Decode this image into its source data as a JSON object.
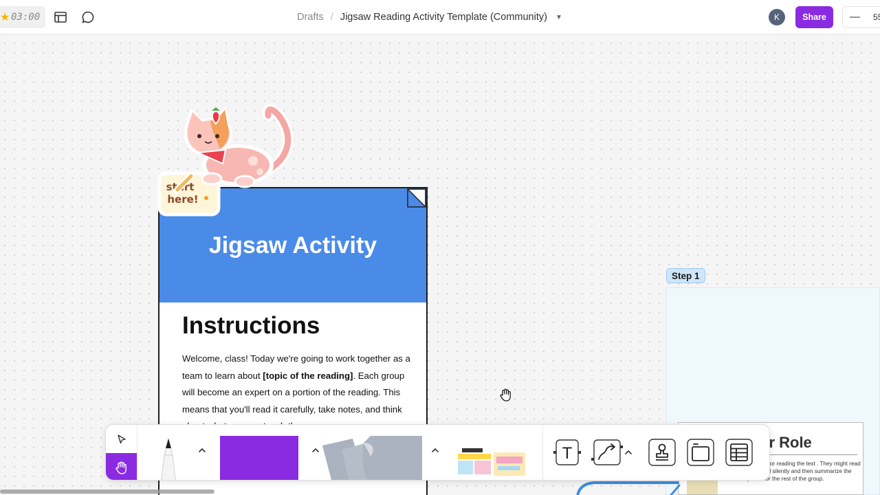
{
  "header": {
    "timer": "03:00",
    "breadcrumb_root": "Drafts",
    "breadcrumb_separator": "/",
    "file_title": "Jigsaw Reading Activity Template (Community)",
    "avatar_initial": "K",
    "share_label": "Share",
    "zoom_minus": "—",
    "zoom_value": "55"
  },
  "canvas": {
    "sticker_text_line1": "start",
    "sticker_text_line2": "here!",
    "card": {
      "title": "Jigsaw Activity",
      "heading": "Instructions",
      "body_before": "Welcome, class! Today we're going to work together as a team to learn about ",
      "body_bold": "[topic of the reading]",
      "body_after": ". Each group will become an expert on a portion of the reading.  This means that you'll read it carefully, take notes, and think about what you can teach the"
    },
    "step_label": "Step 1",
    "role_card": {
      "title": "ur Role",
      "text": "s responsible for reading the text . They might read aloud to their d silently and then summarize the main points for the rest of the group."
    }
  },
  "toolbar": {
    "text_tool_glyph": "T"
  },
  "colors": {
    "accent_purple": "#8a2be2",
    "card_blue": "#4a8be8",
    "step_frame": "#eef8fd"
  }
}
